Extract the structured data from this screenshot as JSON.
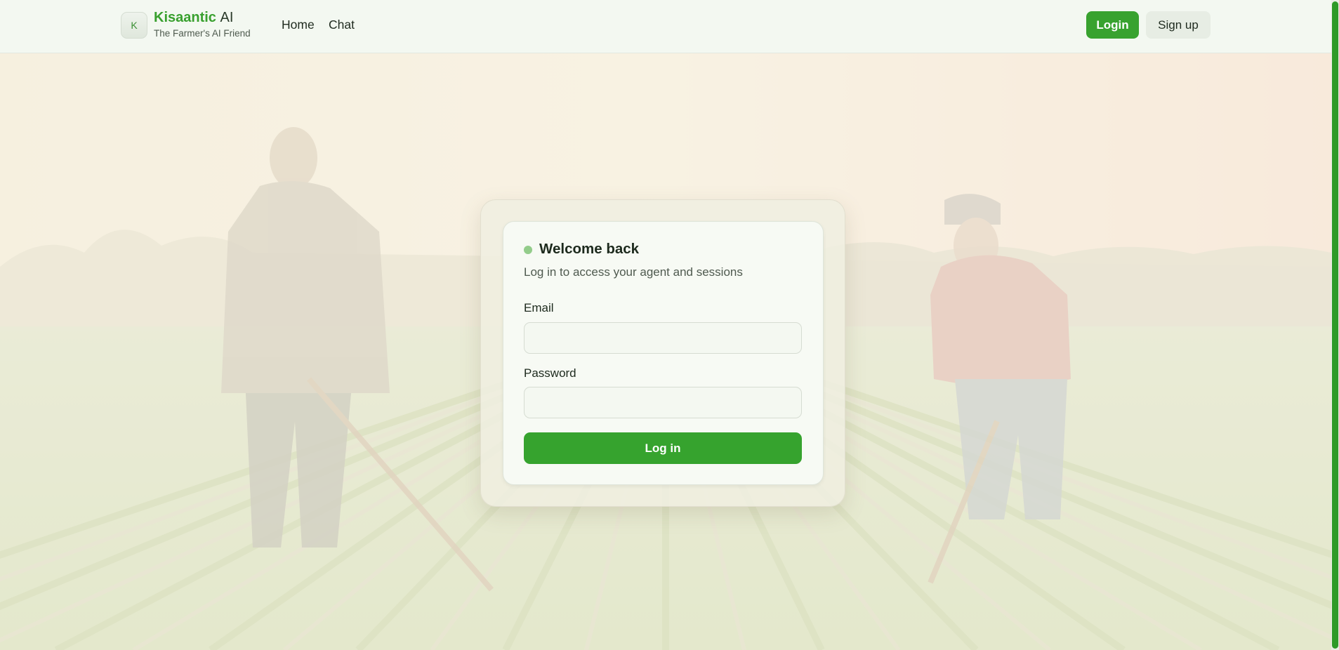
{
  "header": {
    "logo_letter": "K",
    "brand_primary": "Kisaantic",
    "brand_secondary": "AI",
    "tagline": "The Farmer's AI Friend",
    "nav": [
      {
        "label": "Home"
      },
      {
        "label": "Chat"
      }
    ],
    "login_label": "Login",
    "signup_label": "Sign up"
  },
  "login_card": {
    "title": "Welcome back",
    "subtitle": "Log in to access your agent and sessions",
    "email_label": "Email",
    "email_value": "",
    "password_label": "Password",
    "password_value": "",
    "submit_label": "Log in"
  },
  "background": {
    "scene": "farm-field-photo",
    "icons": [
      "farmer-figure",
      "field-rows"
    ]
  },
  "colors": {
    "accent": "#38a22f",
    "brand_green": "#38a02e",
    "header_bg": "#f3f8f1",
    "card_bg": "#f7faf4",
    "status_dot": "#93cc8a"
  }
}
